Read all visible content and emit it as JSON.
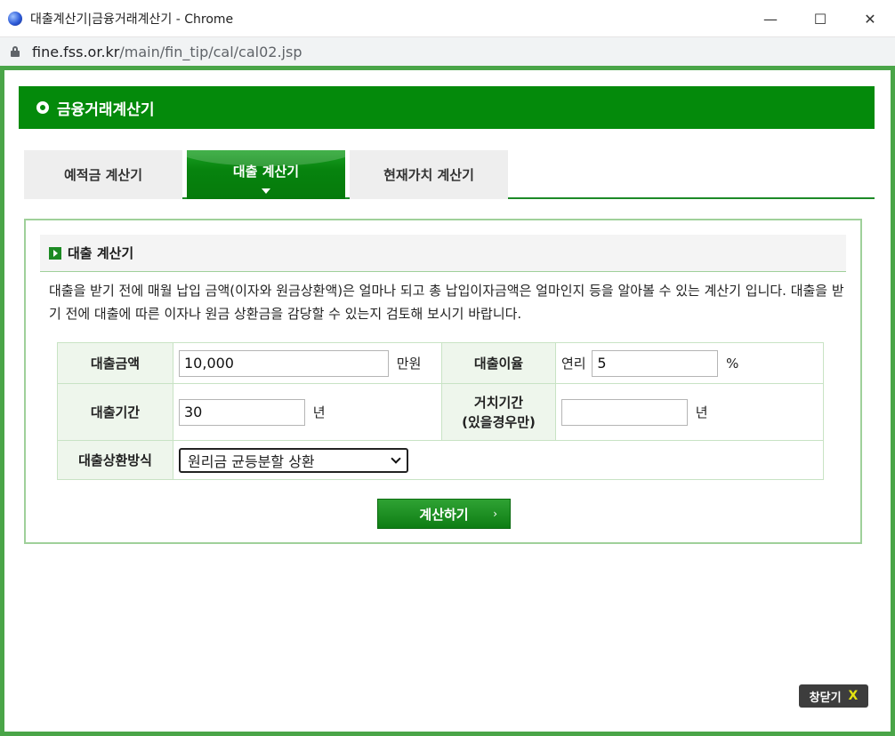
{
  "window": {
    "title": "대출계산기|금융거래계산기 - Chrome",
    "minimize": "—",
    "maximize": "☐",
    "close": "✕"
  },
  "address": {
    "host": "fine.fss.or.kr",
    "path": "/main/fin_tip/cal/cal02.jsp"
  },
  "header": {
    "title": "금융거래계산기"
  },
  "tabs": [
    {
      "label": "예적금 계산기"
    },
    {
      "label": "대출 계산기"
    },
    {
      "label": "현재가치 계산기"
    }
  ],
  "section": {
    "title": "대출 계산기",
    "description": "대출을 받기 전에 매월 납입 금액(이자와 원금상환액)은 얼마나 되고 총 납입이자금액은 얼마인지 등을 알아볼 수 있는 계산기 입니다. 대출을 받기 전에 대출에 따른 이자나 원금 상환금을 감당할 수 있는지 검토해 보시기 바랍니다."
  },
  "form": {
    "amount_label": "대출금액",
    "amount_value": "10,000",
    "amount_unit": "만원",
    "rate_label": "대출이율",
    "rate_prefix": "연리",
    "rate_value": "5",
    "rate_unit": "%",
    "period_label": "대출기간",
    "period_value": "30",
    "period_unit": "년",
    "grace_label_line1": "거치기간",
    "grace_label_line2": "(있을경우만)",
    "grace_value": "",
    "grace_unit": "년",
    "method_label": "대출상환방식",
    "method_value": "원리금 균등분할 상환"
  },
  "buttons": {
    "calculate": "계산하기",
    "calculate_arrow": "›",
    "close_window": "창닫기",
    "close_x": "X"
  }
}
